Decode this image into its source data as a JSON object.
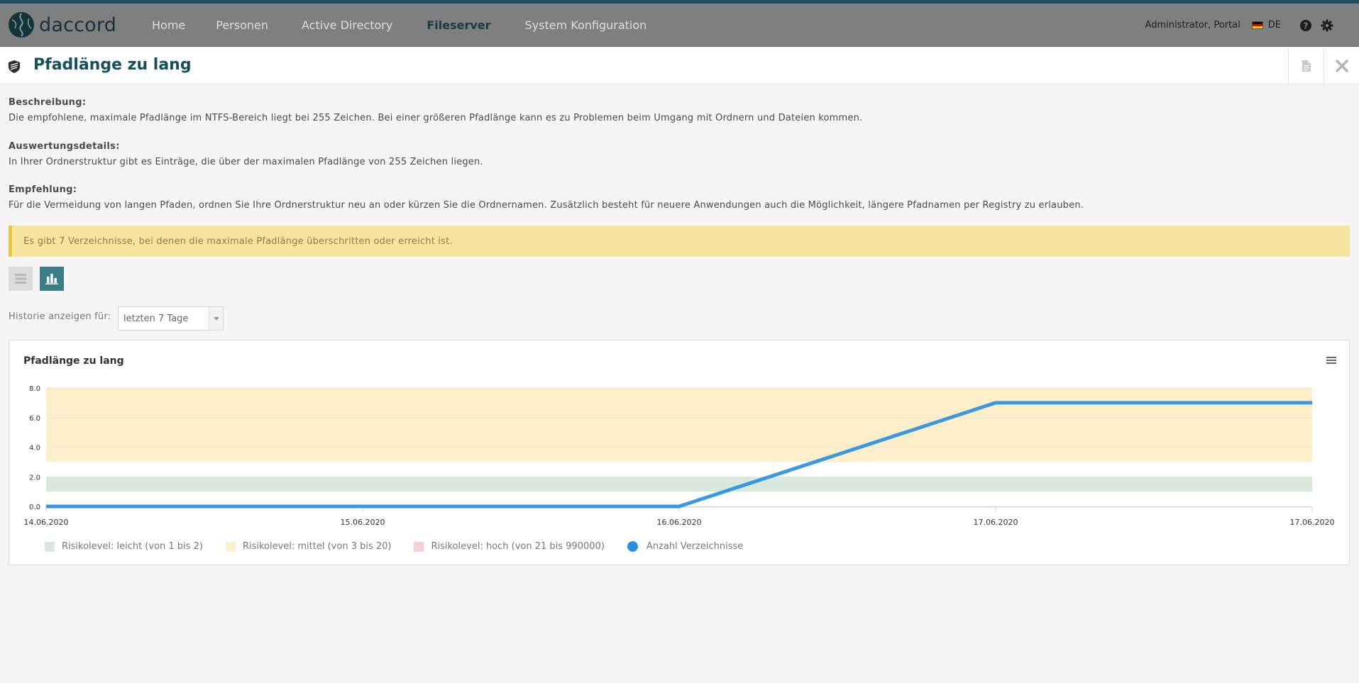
{
  "app": {
    "logo_text": "daccord"
  },
  "nav": {
    "items": [
      {
        "label": "Home",
        "active": false
      },
      {
        "label": "Personen",
        "active": false
      },
      {
        "label": "Active Directory",
        "active": false
      },
      {
        "label": "Fileserver",
        "active": true
      },
      {
        "label": "System Konfiguration",
        "active": false
      }
    ]
  },
  "header": {
    "user": "Administrator, Portal",
    "language": "DE",
    "help_icon": "question-circle-icon",
    "settings_icon": "gear-icon"
  },
  "page": {
    "title": "Pfadlänge zu lang",
    "title_icon": "shield-icon",
    "actions": [
      {
        "icon": "document-icon"
      },
      {
        "icon": "close-icon"
      }
    ]
  },
  "sections": {
    "description": {
      "label": "Beschreibung:",
      "text": "Die empfohlene, maximale Pfadlänge im NTFS-Bereich liegt bei 255 Zeichen. Bei einer größeren Pfadlänge kann es zu Problemen beim Umgang mit Ordnern und Dateien kommen."
    },
    "details": {
      "label": "Auswertungsdetails:",
      "text": "In Ihrer Ordnerstruktur gibt es Einträge, die über der maximalen Pfadlänge von 255 Zeichen liegen."
    },
    "recommendation": {
      "label": "Empfehlung:",
      "text": "Für die Vermeidung von langen Pfaden, ordnen Sie Ihre Ordnerstruktur neu an oder kürzen Sie die Ordnernamen. Zusätzlich besteht für neuere Anwendungen auch die Möglichkeit, längere Pfadnamen per Registry zu erlauben."
    }
  },
  "alert": {
    "text": "Es gibt 7 Verzeichnisse, bei denen die maximale Pfadlänge überschritten oder erreicht ist."
  },
  "view_toggle": {
    "list_icon": "list-icon",
    "chart_icon": "bar-chart-icon",
    "active": "chart"
  },
  "history": {
    "label": "Historie anzeigen für:",
    "selected": "letzten 7 Tage"
  },
  "colors": {
    "accent": "#3c7e88",
    "header_bg": "#7f7f7f",
    "title": "#14505e",
    "alert_bg": "#f6e59e",
    "risk_low": "#d9e8dd",
    "risk_mid": "#fdefc9",
    "risk_high": "#f6d1d1",
    "series": "#2b8fe0"
  },
  "chart_data": {
    "type": "line",
    "title": "Pfadlänge zu lang",
    "x": [
      "14.06.2020",
      "15.06.2020",
      "16.06.2020",
      "17.06.2020",
      "17.06.2020"
    ],
    "ylim": [
      0,
      8
    ],
    "yticks": [
      "0.0",
      "2.0",
      "4.0",
      "6.0",
      "8.0"
    ],
    "series": [
      {
        "name": "Anzahl Verzeichnisse",
        "values": [
          0,
          0,
          0,
          7,
          7
        ]
      }
    ],
    "bands": [
      {
        "name": "Risikolevel: leicht (von 1 bis 2)",
        "from": 1,
        "to": 2,
        "color": "#d9e8dd"
      },
      {
        "name": "Risikolevel: mittel (von 3 bis 20)",
        "from": 3,
        "to": 8,
        "color": "#fdefc9"
      },
      {
        "name": "Risikolevel: hoch (von 21 bis 990000)",
        "from": 21,
        "to": 990000,
        "color": "#f6d1d1"
      }
    ],
    "legend": [
      {
        "label": "Risikolevel: leicht (von 1 bis 2)",
        "color": "#d9e8dd",
        "shape": "square"
      },
      {
        "label": "Risikolevel: mittel (von 3 bis 20)",
        "color": "#fdefc9",
        "shape": "square"
      },
      {
        "label": "Risikolevel: hoch (von 21 bis 990000)",
        "color": "#f6d1d1",
        "shape": "square"
      },
      {
        "label": "Anzahl Verzeichnisse",
        "color": "#2b8fe0",
        "shape": "circle"
      }
    ],
    "legend_position": "bottom-left",
    "grid": true
  }
}
